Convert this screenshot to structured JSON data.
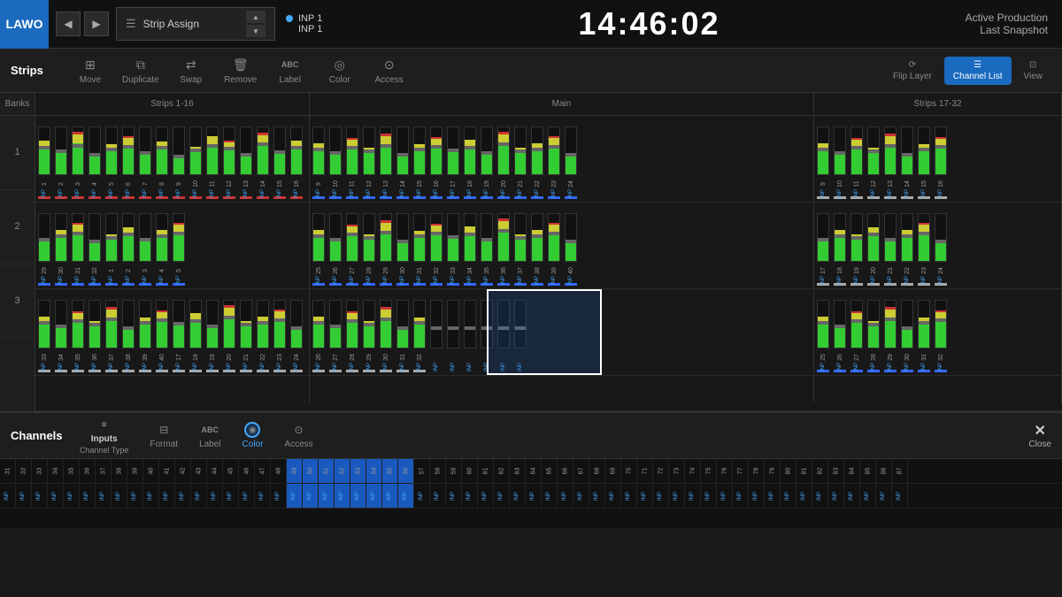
{
  "header": {
    "logo": "LAWO",
    "nav_back": "◀",
    "nav_forward": "▶",
    "strip_assign": "Strip Assign",
    "inp_status_1": "INP  1",
    "inp_status_2": "INP  1",
    "clock": "14:46:02",
    "active_production": "Active Production",
    "last_snapshot": "Last Snapshot"
  },
  "strips_toolbar": {
    "title": "Strips",
    "items": [
      {
        "icon": "⊞",
        "label": "Move"
      },
      {
        "icon": "⧉",
        "label": "Duplicate"
      },
      {
        "icon": "⇄",
        "label": "Swap"
      },
      {
        "icon": "🗑",
        "label": "Remove"
      },
      {
        "icon": "ABC",
        "label": "Label"
      },
      {
        "icon": "◉",
        "label": "Color"
      },
      {
        "icon": "🔒",
        "label": "Access"
      }
    ],
    "right": [
      {
        "icon": "⟳",
        "label": "Flip Layer"
      },
      {
        "icon": "☰",
        "label": "Channel List",
        "active": true
      },
      {
        "icon": "👁",
        "label": "View"
      }
    ]
  },
  "banks": {
    "header": "Banks",
    "rows": [
      "1",
      "2",
      "3"
    ]
  },
  "sections": {
    "strips_1_16": "Strips 1-16",
    "main": "Main",
    "strips_17_32": "Strips 17-32"
  },
  "channels_toolbar": {
    "title": "Channels",
    "inputs_label": "Inputs",
    "channel_type": "Channel Type",
    "format_label": "Format",
    "label_label": "Label",
    "color_label": "Color",
    "access_label": "Access",
    "close_label": "Close"
  },
  "colors": {
    "accent_blue": "#1a6abf",
    "green": "#33cc33",
    "yellow": "#cccc33",
    "red": "#cc3333",
    "blue_indicator": "#3366ff"
  }
}
